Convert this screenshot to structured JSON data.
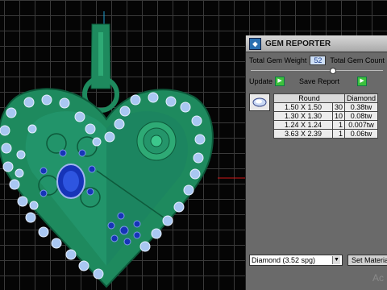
{
  "app": {
    "panel_title": "GEM REPORTER",
    "app_icon": "gem-reporter-icon"
  },
  "panel": {
    "total_weight_label": "Total Gem Weight",
    "total_weight_value": "52",
    "total_count_label": "Total Gem Count",
    "update_label": "Update",
    "save_report_label": "Save Report"
  },
  "table": {
    "headers": [
      "Round",
      "Diamond"
    ],
    "rows": [
      {
        "size": "1.50 X 1.50",
        "qty": "30",
        "weight": "0.38tw"
      },
      {
        "size": "1.30 X 1.30",
        "qty": "10",
        "weight": "0.08tw"
      },
      {
        "size": "1.24 X 1.24",
        "qty": "1",
        "weight": "0.007tw"
      },
      {
        "size": "3.63 X 2.39",
        "qty": "1",
        "weight": "0.06tw"
      }
    ]
  },
  "footer": {
    "material_selected": "Diamond  (3.52 spg)",
    "set_material_label": "Set Materia"
  },
  "watermark": "Ac",
  "colors": {
    "metal": "#1e8a5e",
    "diamond": "#a9c7f2",
    "sapphire": "#1634b8",
    "accent_line": "#d01818"
  }
}
